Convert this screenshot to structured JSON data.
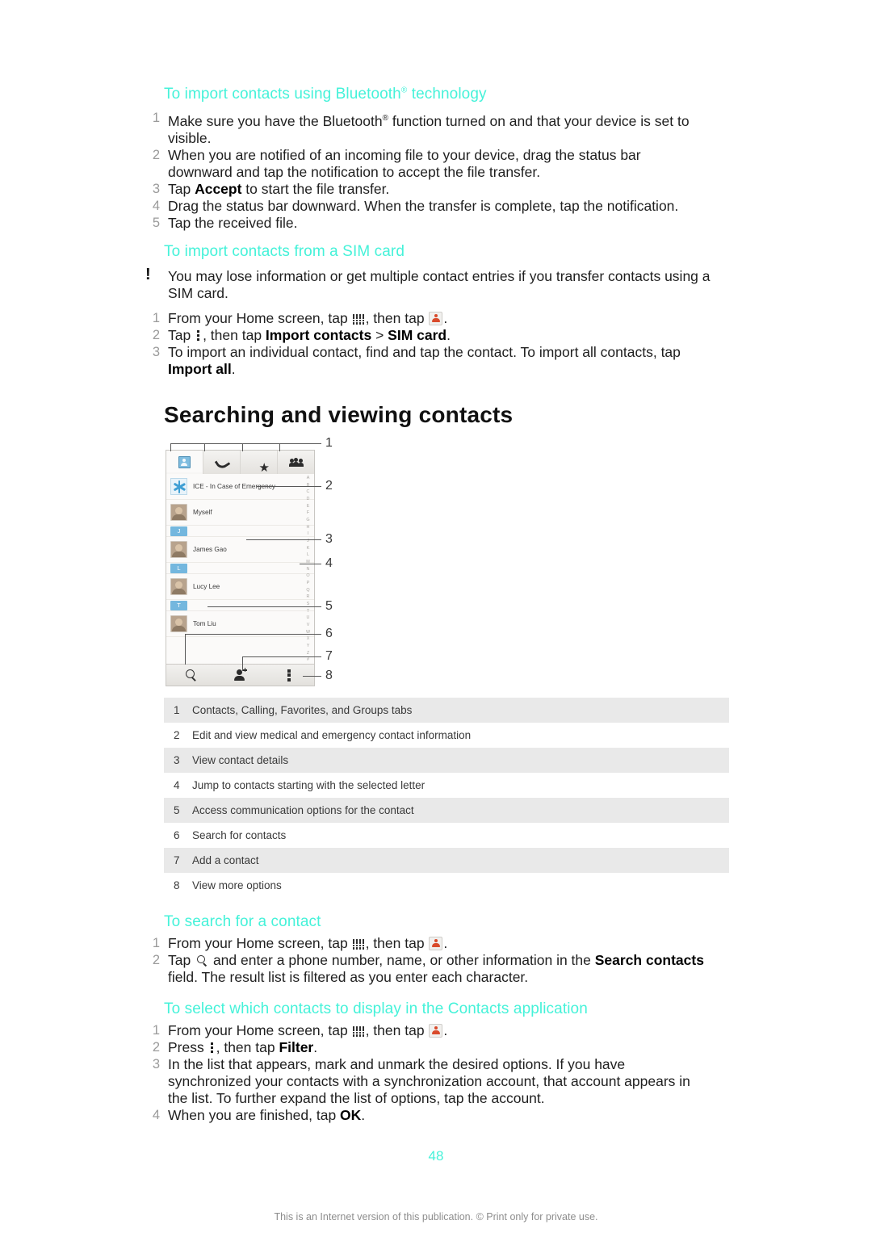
{
  "sections": {
    "bluetooth": {
      "heading_pre": "To import contacts using Bluetooth",
      "heading_post": " technology",
      "steps": [
        {
          "n": "1",
          "text_a": "Make sure you have the Bluetooth",
          "text_b": " function turned on and that your device is set to visible."
        },
        {
          "n": "2",
          "text_a": "When you are notified of an incoming file to your device, drag the status bar downward and tap the notification to accept the file transfer.",
          "text_b": ""
        },
        {
          "n": "3",
          "text_a": "Tap ",
          "bold": "Accept",
          "text_b": " to start the file transfer."
        },
        {
          "n": "4",
          "text_a": "Drag the status bar downward. When the transfer is complete, tap the notification.",
          "text_b": ""
        },
        {
          "n": "5",
          "text_a": "Tap the received file.",
          "text_b": ""
        }
      ]
    },
    "simcard": {
      "heading": "To import contacts from a SIM card",
      "note_marker": "!",
      "note": "You may lose information or get multiple contact entries if you transfer contacts using a SIM card.",
      "steps": [
        {
          "n": "1",
          "a": "From your Home screen, tap ",
          "b": ", then tap ",
          "c": "."
        },
        {
          "n": "2",
          "a": "Tap ",
          "b": ", then tap ",
          "bold1": "Import contacts",
          "sep": " > ",
          "bold2": "SIM card",
          "c": "."
        },
        {
          "n": "3",
          "a": "To import an individual contact, find and tap the contact. To import all contacts, tap ",
          "bold1": "Import all",
          "c": "."
        }
      ]
    },
    "searching": {
      "title": "Searching and viewing contacts"
    },
    "search_contact": {
      "heading": "To search for a contact",
      "steps": [
        {
          "n": "1",
          "a": "From your Home screen, tap ",
          "b": ", then tap ",
          "c": "."
        },
        {
          "n": "2",
          "a": "Tap ",
          "b": " and enter a phone number, name, or other information in the ",
          "bold1": "Search contacts",
          "c": " field. The result list is filtered as you enter each character."
        }
      ]
    },
    "select_contacts": {
      "heading": "To select which contacts to display in the Contacts application",
      "steps": [
        {
          "n": "1",
          "a": "From your Home screen, tap ",
          "b": ", then tap ",
          "c": "."
        },
        {
          "n": "2",
          "a": "Press ",
          "b": ", then tap ",
          "bold1": "Filter",
          "c": "."
        },
        {
          "n": "3",
          "a": "In the list that appears, mark and unmark the desired options. If you have synchronized your contacts with a synchronization account, that account appears in the list. To further expand the list of options, tap the account.",
          "c": ""
        },
        {
          "n": "4",
          "a": "When you are finished, tap ",
          "bold1": "OK",
          "c": "."
        }
      ]
    }
  },
  "figure": {
    "tabs": [
      {
        "name": "contacts-tab",
        "icon": "contacts-icon",
        "active": true
      },
      {
        "name": "calling-tab",
        "icon": "phone-icon",
        "active": false
      },
      {
        "name": "favorites-tab",
        "icon": "star-icon",
        "active": false
      },
      {
        "name": "groups-tab",
        "icon": "groups-icon",
        "active": false
      }
    ],
    "rows": [
      {
        "type": "ice",
        "label": "ICE - In Case of Emergency"
      },
      {
        "type": "contact",
        "label": "Myself"
      },
      {
        "type": "index",
        "label": "J"
      },
      {
        "type": "contact",
        "label": "James Gao"
      },
      {
        "type": "index",
        "label": "L"
      },
      {
        "type": "contact",
        "label": "Lucy Lee"
      },
      {
        "type": "index",
        "label": "T"
      },
      {
        "type": "contact",
        "label": "Tom Liu"
      }
    ],
    "alpha_index": [
      "A",
      "B",
      "C",
      "D",
      "E",
      "F",
      "G",
      "H",
      "I",
      "J",
      "K",
      "L",
      "M",
      "N",
      "O",
      "P",
      "Q",
      "R",
      "S",
      "T",
      "U",
      "V",
      "W",
      "X",
      "Y",
      "Z",
      "#"
    ],
    "bottom_bar": [
      {
        "name": "search-icon"
      },
      {
        "name": "add-contact-icon"
      },
      {
        "name": "more-options-icon"
      }
    ],
    "callouts": [
      "1",
      "2",
      "3",
      "4",
      "5",
      "6",
      "7",
      "8"
    ]
  },
  "legend": {
    "rows": [
      {
        "n": "1",
        "text": "Contacts, Calling, Favorites, and Groups tabs"
      },
      {
        "n": "2",
        "text": "Edit and view medical and emergency contact information"
      },
      {
        "n": "3",
        "text": "View contact details"
      },
      {
        "n": "4",
        "text": "Jump to contacts starting with the selected letter"
      },
      {
        "n": "5",
        "text": "Access communication options for the contact"
      },
      {
        "n": "6",
        "text": "Search for contacts"
      },
      {
        "n": "7",
        "text": "Add a contact"
      },
      {
        "n": "8",
        "text": "View more options"
      }
    ]
  },
  "footer": {
    "page_number": "48",
    "note": "This is an Internet version of this publication. © Print only for private use."
  },
  "colors": {
    "heading": "#45F2D9",
    "body": "#1f1f1f",
    "legend_shade": "#e9e9e9",
    "accent_blue": "#74b7de"
  }
}
